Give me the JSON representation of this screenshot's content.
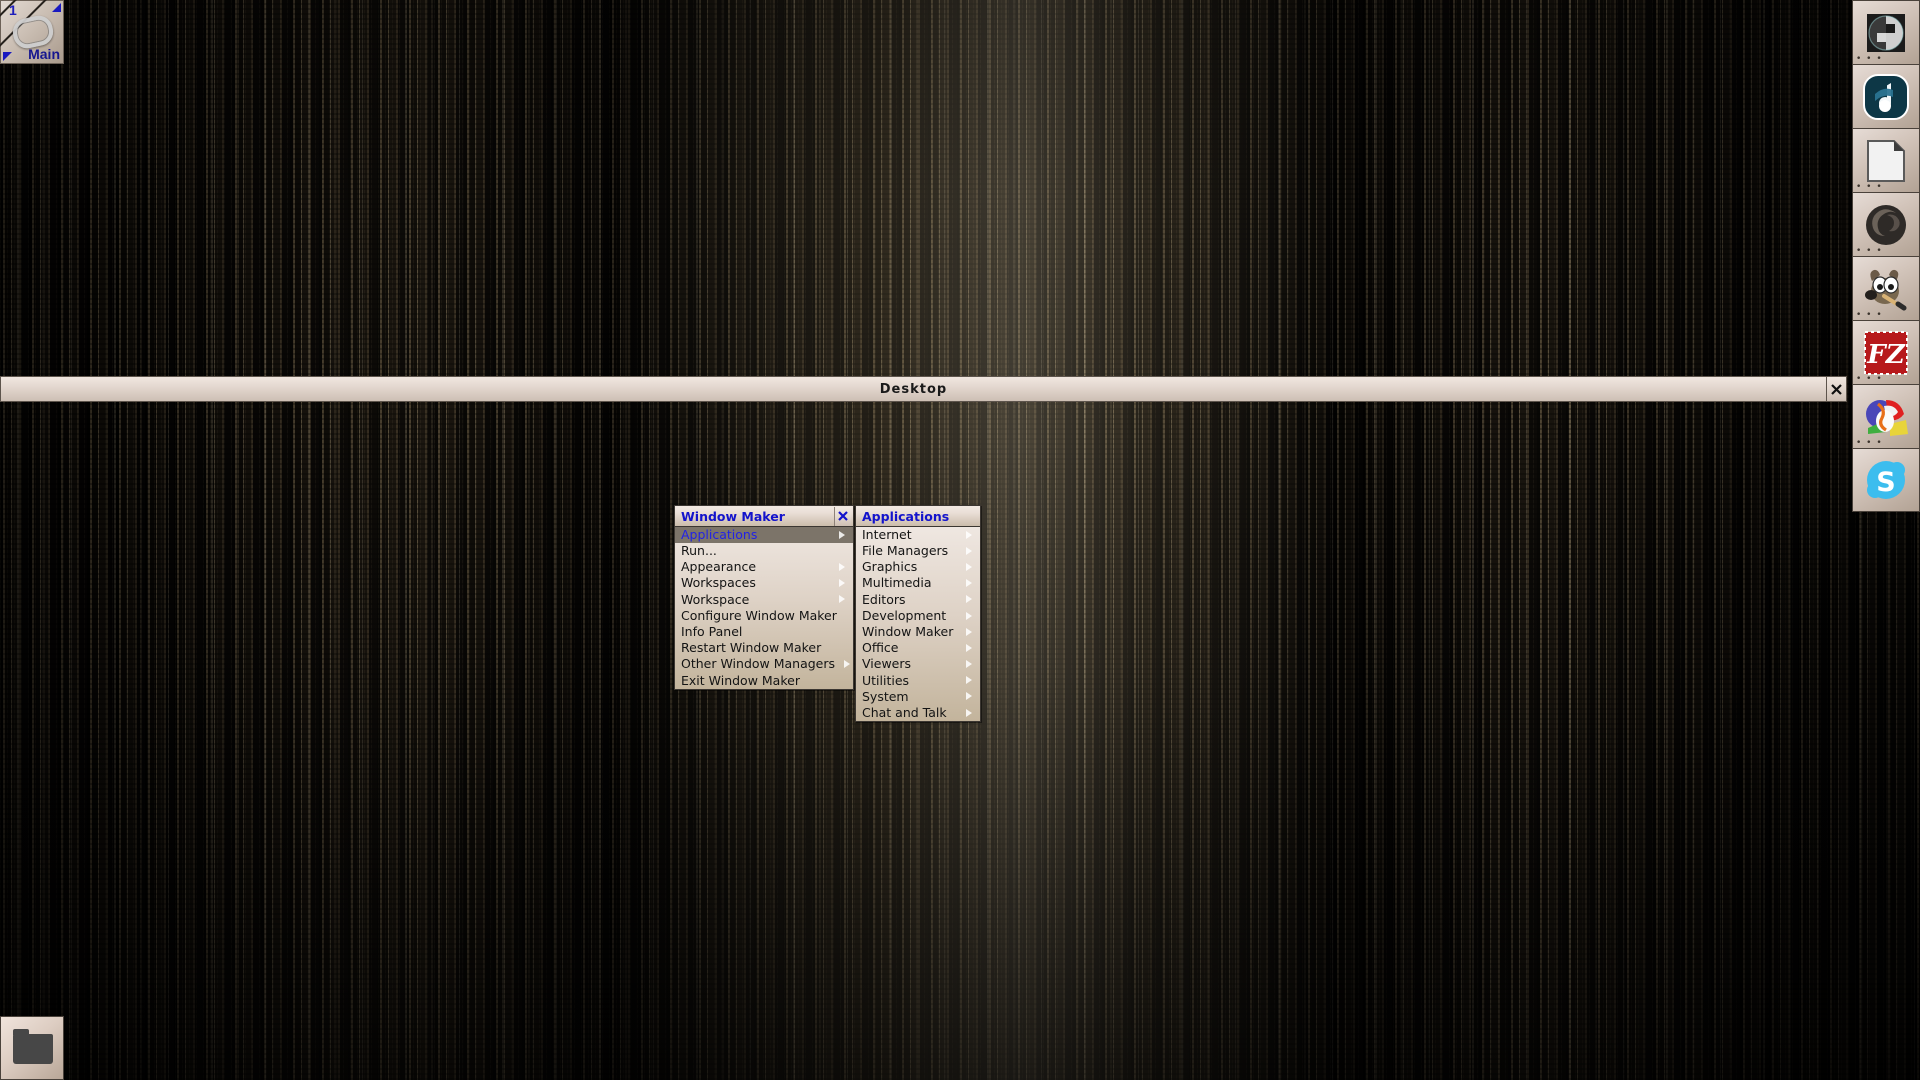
{
  "desktop": {
    "wallpaper_name": "dark-vertical-streaks",
    "background_color": "#100d08"
  },
  "workspace_clip": {
    "number": "1",
    "name": "Main",
    "prev_arrow_icon": "triangle-left-icon",
    "next_arrow_icon": "triangle-right-icon",
    "clip_icon": "paperclip-icon"
  },
  "desktop_window": {
    "title": "Desktop",
    "close_icon": "close-x-icon"
  },
  "root_menu": {
    "title": "Window Maker",
    "close_icon": "close-x-icon",
    "items": [
      {
        "label": "Applications",
        "submenu": true,
        "selected": true
      },
      {
        "label": "Run...",
        "submenu": false,
        "selected": false
      },
      {
        "label": "Appearance",
        "submenu": true,
        "selected": false
      },
      {
        "label": "Workspaces",
        "submenu": true,
        "selected": false
      },
      {
        "label": "Workspace",
        "submenu": true,
        "selected": false
      },
      {
        "label": "Configure Window Maker",
        "submenu": false,
        "selected": false
      },
      {
        "label": "Info Panel",
        "submenu": false,
        "selected": false
      },
      {
        "label": "Restart Window Maker",
        "submenu": false,
        "selected": false
      },
      {
        "label": "Other Window Managers",
        "submenu": true,
        "selected": false
      },
      {
        "label": "Exit Window Maker",
        "submenu": false,
        "selected": false
      }
    ]
  },
  "applications_menu": {
    "title": "Applications",
    "items": [
      {
        "label": "Internet",
        "submenu": true
      },
      {
        "label": "File Managers",
        "submenu": true
      },
      {
        "label": "Graphics",
        "submenu": true
      },
      {
        "label": "Multimedia",
        "submenu": true
      },
      {
        "label": "Editors",
        "submenu": true
      },
      {
        "label": "Development",
        "submenu": true
      },
      {
        "label": "Window Maker",
        "submenu": true
      },
      {
        "label": "Office",
        "submenu": true
      },
      {
        "label": "Viewers",
        "submenu": true
      },
      {
        "label": "Utilities",
        "submenu": true
      },
      {
        "label": "System",
        "submenu": true
      },
      {
        "label": "Chat and Talk",
        "submenu": true
      }
    ]
  },
  "dock": {
    "dots_glyph": "• • •",
    "items": [
      {
        "icon": "window-maker-logo-icon",
        "dots": "• • •"
      },
      {
        "icon": "audio-player-icon",
        "dots": ""
      },
      {
        "icon": "document-icon",
        "dots": "• • •"
      },
      {
        "icon": "firefox-browser-icon",
        "dots": "• • •"
      },
      {
        "icon": "gimp-wilber-icon",
        "dots": "• • •"
      },
      {
        "icon": "filezilla-icon",
        "dots": "• • •"
      },
      {
        "icon": "colorful-paint-icon",
        "dots": "• • •"
      },
      {
        "icon": "skype-icon",
        "dots": ""
      }
    ]
  },
  "minimized_icon": {
    "icon": "folder-icon"
  },
  "colors": {
    "menu_title_text": "#1313cc",
    "menu_selected_bg": "#7c7469",
    "menu_body_top": "#efe7e1",
    "menu_body_bottom": "#c3b49c",
    "titlebar_text": "#1a1a1a"
  }
}
